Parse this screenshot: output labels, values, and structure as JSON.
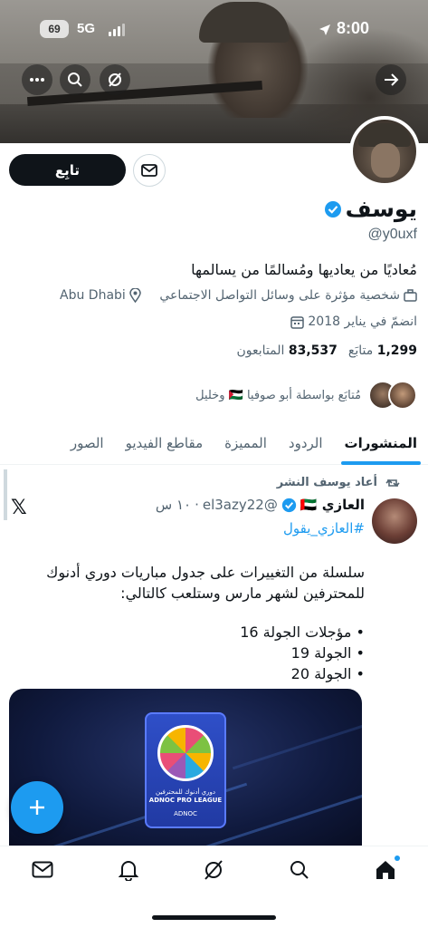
{
  "status_bar": {
    "battery": "69",
    "network": "5G",
    "time": "8:00"
  },
  "profile": {
    "name": "يوسف",
    "handle": "@y0uxf",
    "bio": "مُعاديًا من يعاديها ومُسالمًا من يسالمها",
    "category": "شخصية مؤثرة على وسائل التواصل الاجتماعي",
    "location": "Abu Dhabi",
    "joined": "انضمّ في يناير 2018",
    "following_count": "1,299",
    "following_label": "متابَع",
    "followers_count": "83,537",
    "followers_label": "المتابعون",
    "followed_by": "مُتابَع بواسطة أبو صوفيا 🇵🇸 وخليل",
    "follow_label": "تابِع",
    "accent": "#1d9bf0"
  },
  "tabs": [
    {
      "label": "المنشورات",
      "active": true
    },
    {
      "label": "الردود"
    },
    {
      "label": "المميزة"
    },
    {
      "label": "مقاطع الفيديو"
    },
    {
      "label": "الصور"
    }
  ],
  "post": {
    "repost_label": "أعاد يوسف النشر",
    "author_name": "العازي 🇦🇪",
    "author_handle": "@el3azy22",
    "time": "١٠ س",
    "hashtag": "#العازي_يقول",
    "text": "سلسلة من التغييرات على جدول مباريات دوري أدنوك للمحترفين لشهر مارس وستلعب كالتالي:",
    "items": [
      "مؤجلات الجولة 16",
      "الجولة 19",
      "الجولة 20"
    ],
    "media": {
      "league_ar": "دوري أدنوك للمحترفين",
      "league_en": "ADNOC PRO LEAGUE",
      "brand": "ADNOC"
    }
  }
}
